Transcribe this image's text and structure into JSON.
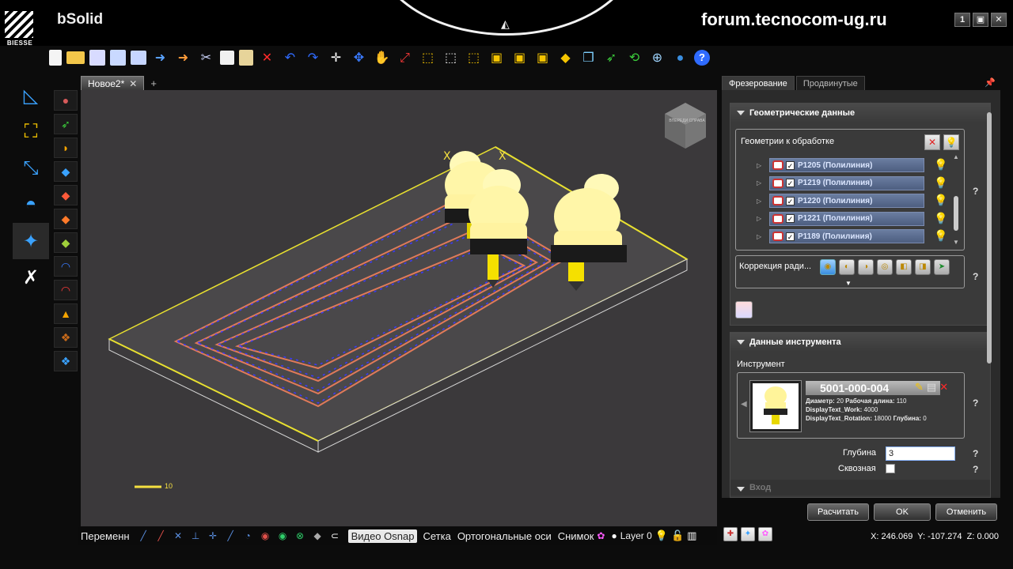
{
  "brand": {
    "logo_text": "BIESSE",
    "app_name": "bSolid"
  },
  "watermark": "forum.tecnocom-ug.ru",
  "window_controls": [
    "1",
    "▣",
    "✕"
  ],
  "toolbar_icons": [
    "new-file",
    "open-folder",
    "save",
    "save-as",
    "print",
    "import",
    "export",
    "cut",
    "copy",
    "paste",
    "delete",
    "undo",
    "redo",
    "snap-target",
    "origin",
    "pan",
    "zoom-extents",
    "view-box-1",
    "view-box-2",
    "view-box-3",
    "view-box-4",
    "view-box-5",
    "view-box-6",
    "view-box-7",
    "view-iso",
    "arrow-green",
    "rotate",
    "globe-wire",
    "globe",
    "help"
  ],
  "left_tools": [
    "measure-triangle",
    "resize-frame",
    "dimension-arrow",
    "protractor",
    "machining-tool",
    "wrench-screwdriver"
  ],
  "left_sub_tools": 13,
  "document": {
    "tab_label": "Новое2*"
  },
  "viewport": {
    "scale_label": "10"
  },
  "statusbar": {
    "variable_label": "Переменн",
    "video_osnap": "Видео Osnap",
    "grid": "Сетка",
    "ortho": "Ортогональные оси",
    "snapshot": "Снимок",
    "layer": "Layer 0"
  },
  "right_panel": {
    "tabs": [
      "Фрезерование",
      "Продвинутые"
    ],
    "geometry_section": {
      "title": "Геометрические данные",
      "geometries_label": "Геометрии к обработке",
      "items": [
        {
          "label": "P1205 (Полилиния)",
          "checked": "✓"
        },
        {
          "label": "P1219 (Полилиния)",
          "checked": "✓"
        },
        {
          "label": "P1220 (Полилиния)",
          "checked": "✓"
        },
        {
          "label": "P1221 (Полилиния)",
          "checked": "✓"
        },
        {
          "label": "P1189 (Полилиния)",
          "checked": "✓"
        }
      ],
      "radius_correction_label": "Коррекция ради..."
    },
    "tool_section": {
      "title": "Данные инструмента",
      "tool_label": "Инструмент",
      "tool_id": "5001-000-004",
      "info_line1_a": "Диаметр:",
      "info_line1_b": "20",
      "info_line1_c": "Рабочая длина:",
      "info_line1_d": "110",
      "info_line2_a": "DisplayText_Work:",
      "info_line2_b": "4000",
      "info_line3_a": "DisplayText_Rotation:",
      "info_line3_b": "18000",
      "info_line3_c": "Глубина:",
      "info_line3_d": "0",
      "depth_label": "Глубина",
      "depth_value": "3",
      "through_label": "Сквозная"
    },
    "entry_section": {
      "title": "Вход"
    },
    "help": "?"
  },
  "buttons": {
    "calculate": "Расчитать",
    "ok": "OK",
    "cancel": "Отменить"
  },
  "coords": {
    "x": "X: 246.069",
    "y": "Y: -107.274",
    "z": "Z: 0.000"
  },
  "viewcube_text": "ВПЕРЕДИ СПРАВА",
  "colors": {
    "accent": "#f5c400",
    "viewport_bg": "#3b393b",
    "selection": "#e9e9e9"
  }
}
